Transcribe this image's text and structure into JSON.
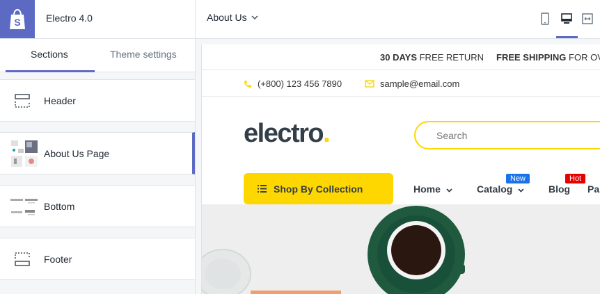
{
  "topbar": {
    "theme_name": "Electro 4.0",
    "page_select": "About Us",
    "logo_icon": "shopify-bag-icon",
    "device_icons": [
      "mobile-icon",
      "desktop-icon",
      "full-width-icon"
    ]
  },
  "sidebar": {
    "tabs": [
      {
        "label": "Sections"
      },
      {
        "label": "Theme settings"
      }
    ],
    "items": [
      {
        "label": "Header",
        "icon": "header-layout-icon"
      },
      {
        "label": "About Us Page",
        "icon": "thumbnail"
      },
      {
        "label": "Bottom",
        "icon": "thumbnail"
      },
      {
        "label": "Footer",
        "icon": "footer-layout-icon"
      }
    ]
  },
  "preview": {
    "promo1_bold": "30 DAYS",
    "promo1_rest": " FREE RETURN",
    "promo2_bold": "FREE SHIPPING",
    "promo2_rest": " FOR OVE",
    "phone": "(+800) 123 456 7890",
    "email": "sample@email.com",
    "brand": "electro",
    "brand_dot": ".",
    "search_placeholder": "Search",
    "shop_button": "Shop By Collection",
    "nav": [
      {
        "label": "Home"
      },
      {
        "label": "Catalog",
        "badge": "New"
      },
      {
        "label": "Blog",
        "badge": "Hot"
      },
      {
        "label": "Pa"
      }
    ]
  },
  "colors": {
    "accent": "#5c6ac4",
    "brand_yellow": "#fed700",
    "badge_new": "#1a73e8",
    "badge_hot": "#e60000"
  }
}
